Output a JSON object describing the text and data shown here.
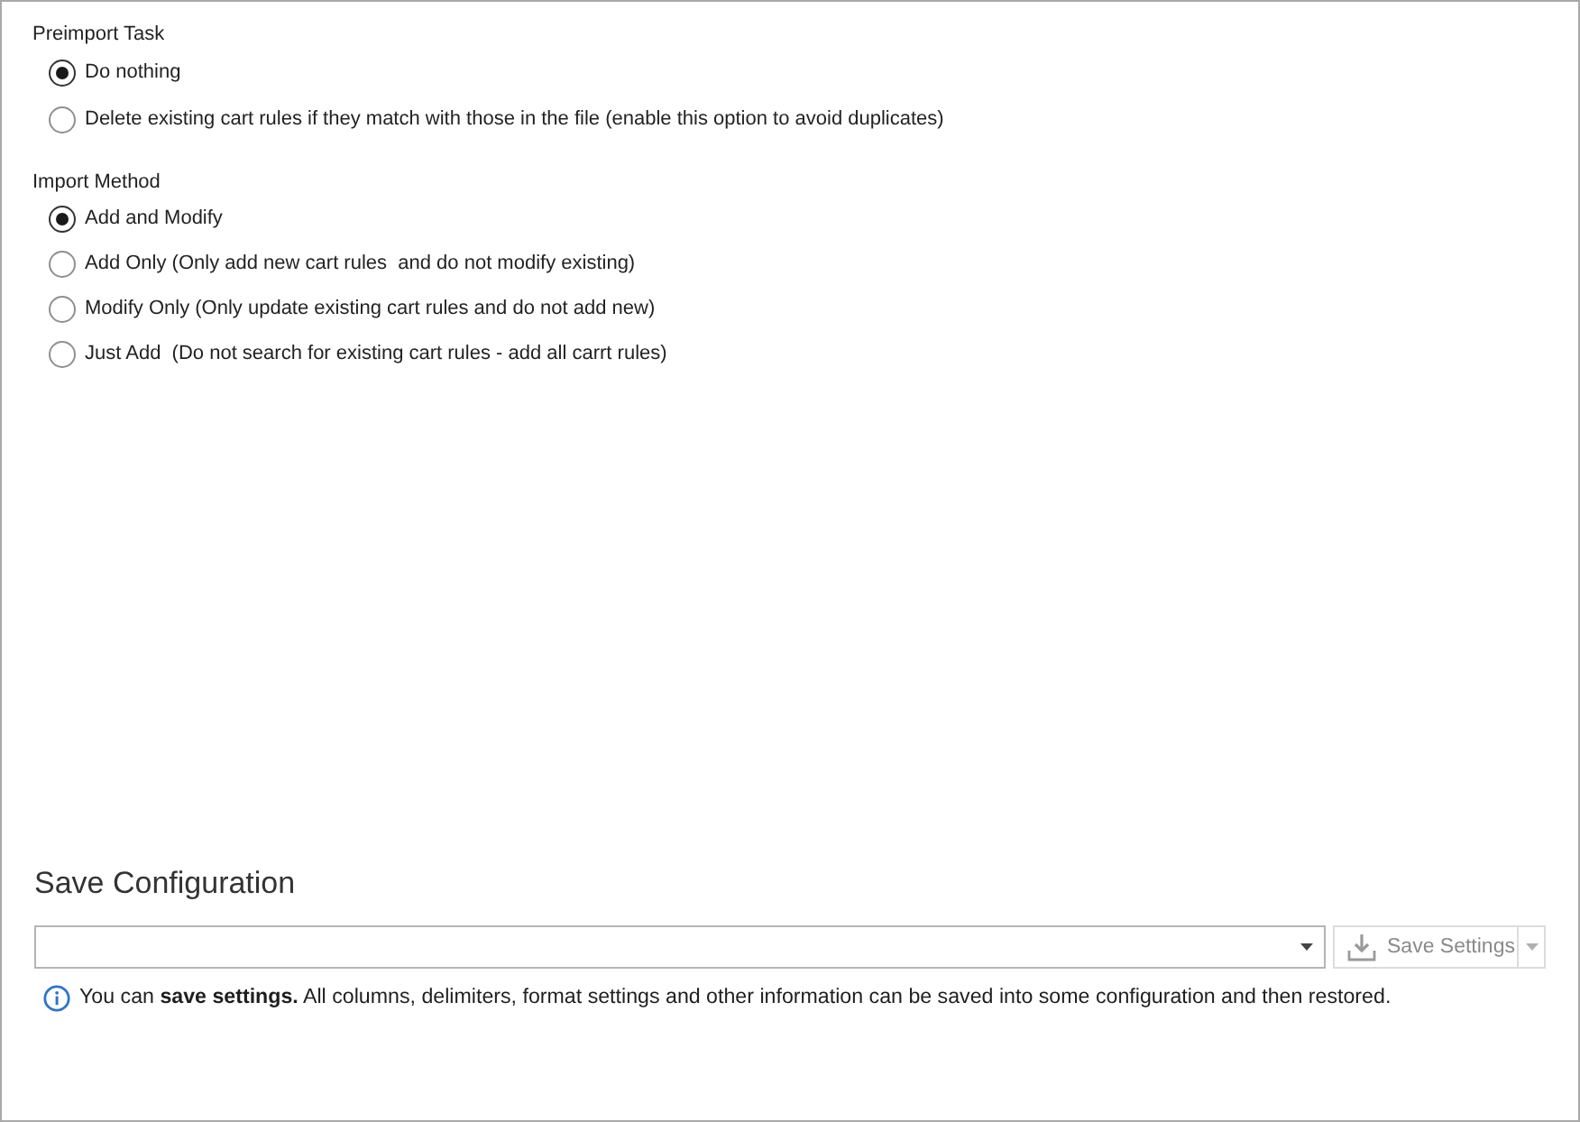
{
  "preimport_task": {
    "label": "Preimport Task",
    "options": [
      {
        "label": "Do nothing",
        "selected": true
      },
      {
        "label": "Delete existing cart rules if they match with those in the file (enable this option to avoid duplicates)",
        "selected": false
      }
    ]
  },
  "import_method": {
    "label": "Import Method",
    "options": [
      {
        "label": "Add and Modify",
        "selected": true
      },
      {
        "label": "Add Only (Only add new cart rules  and do not modify existing)",
        "selected": false
      },
      {
        "label": "Modify Only (Only update existing cart rules and do not add new)",
        "selected": false
      },
      {
        "label": "Just Add  (Do not search for existing cart rules - add all carrt rules)",
        "selected": false
      }
    ]
  },
  "save_configuration": {
    "title": "Save Configuration",
    "save_button": {
      "label": "Save Settings",
      "disabled": true
    },
    "info": "You can **save settings.** All columns, delimiters, format settings and other information can be saved into some configuration and then restored."
  }
}
